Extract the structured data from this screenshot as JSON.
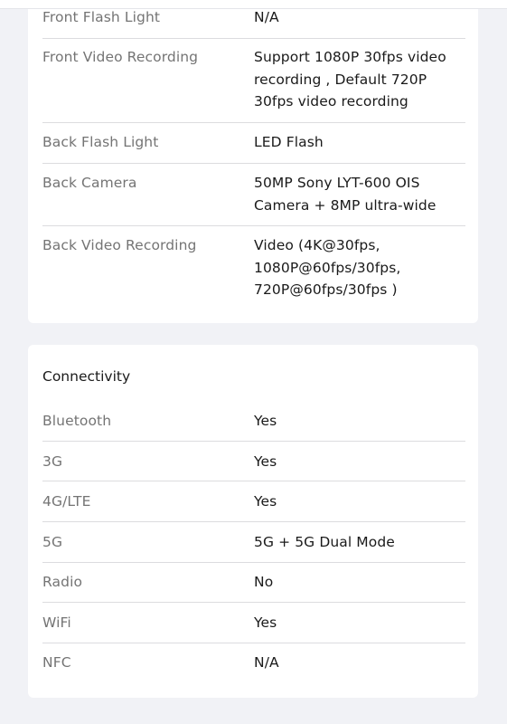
{
  "camera_section": {
    "rows": [
      {
        "label": "Front Flash Light",
        "value": "N/A"
      },
      {
        "label": "Front Video Recording",
        "value_lines": [
          "Support 1080P 30fps video",
          "recording , Default 720P",
          "30fps video recording"
        ]
      },
      {
        "label": "Back Flash Light",
        "value": "LED Flash"
      },
      {
        "label": "Back Camera",
        "value_lines": [
          "50MP Sony LYT-600 OIS",
          "Camera + 8MP ultra-wide"
        ]
      },
      {
        "label": "Back Video Recording",
        "value_lines": [
          "Video (4K@30fps,",
          "1080P@60fps/30fps,",
          "720P@60fps/30fps )"
        ]
      }
    ]
  },
  "connectivity_section": {
    "title": "Connectivity",
    "rows": [
      {
        "label": "Bluetooth",
        "value": "Yes"
      },
      {
        "label": "3G",
        "value": "Yes"
      },
      {
        "label": "4G/LTE",
        "value": "Yes"
      },
      {
        "label": "5G",
        "value": "5G + 5G Dual Mode"
      },
      {
        "label": "Radio",
        "value": "No"
      },
      {
        "label": "WiFi",
        "value": "Yes"
      },
      {
        "label": "NFC",
        "value": "N/A"
      }
    ]
  }
}
